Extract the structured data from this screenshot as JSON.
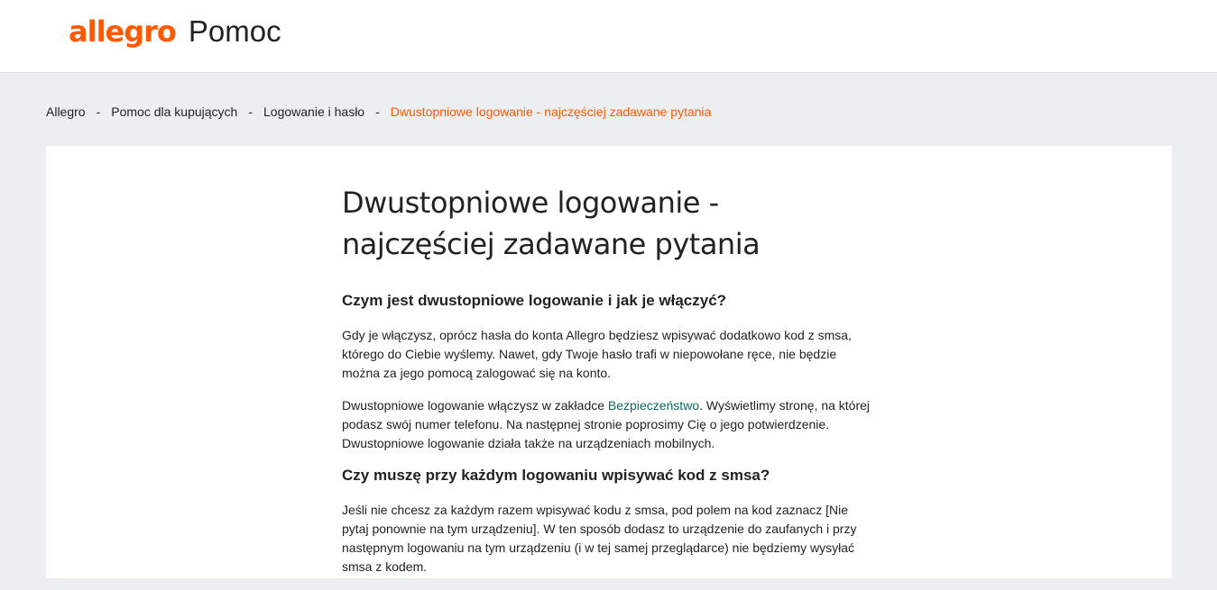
{
  "header": {
    "logo_text": "allegro",
    "section_title": "Pomoc"
  },
  "breadcrumb": {
    "items": [
      "Allegro",
      "Pomoc dla kupujących",
      "Logowanie i hasło",
      "Dwustopniowe logowanie - najczęściej zadawane pytania"
    ],
    "separator": "-"
  },
  "article": {
    "title_line1": "Dwustopniowe logowanie -",
    "title_line2": "najczęściej zadawane pytania",
    "sections": [
      {
        "heading": "Czym jest dwustopniowe logowanie i jak je włączyć?",
        "p1": "Gdy je włączysz, oprócz hasła do konta Allegro będziesz wpisywać dodatkowo kod z smsa, którego do Ciebie wyślemy. Nawet, gdy Twoje hasło trafi w niepowołane ręce, nie będzie można za jego pomocą zalogować się na konto.",
        "p2_before": "Dwustopniowe logowanie włączysz w zakładce ",
        "p2_link": "Bezpieczeństwo",
        "p2_after": ". Wyświetlimy stronę, na której podasz swój numer telefonu. Na następnej stronie poprosimy Cię o jego potwierdzenie. Dwustopniowe logowanie działa także na urządzeniach mobilnych."
      },
      {
        "heading": "Czy muszę przy każdym logowaniu wpisywać kod z smsa?",
        "p1": "Jeśli nie chcesz za każdym razem wpisywać kodu z smsa, pod polem na kod zaznacz [Nie pytaj ponownie na tym urządzeniu]. W ten sposób dodasz to urządzenie do zaufanych i przy następnym logowaniu na tym urządzeniu (i w tej samej przeglądarce) nie będziemy wysyłać smsa z kodem."
      }
    ]
  },
  "colors": {
    "brand": "#ff5a00",
    "link": "#0b6a5a",
    "page_background": "#eceff1",
    "text": "#222222"
  }
}
